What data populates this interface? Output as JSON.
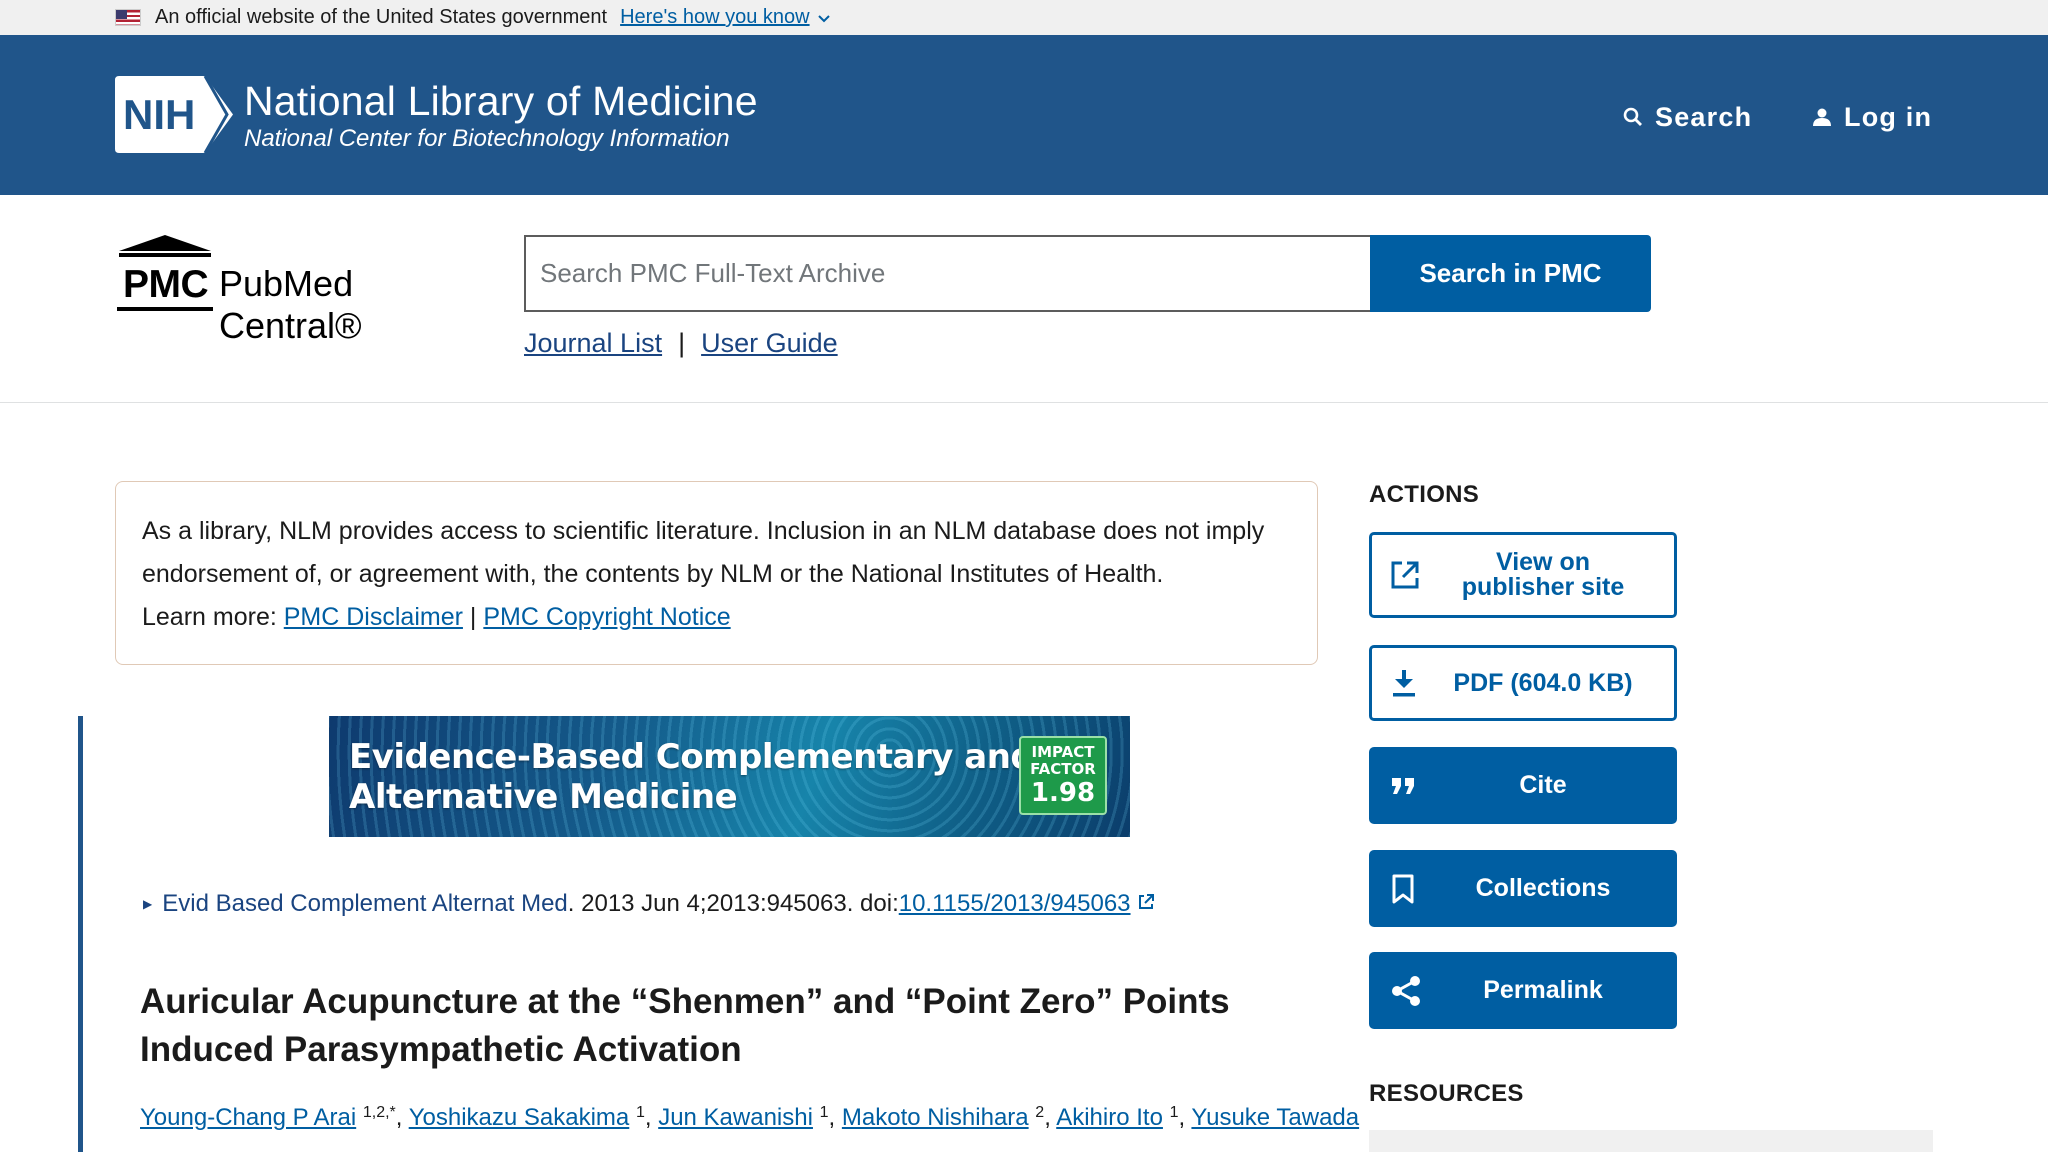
{
  "gov_banner": {
    "text": "An official website of the United States government",
    "link": "Here's how you know"
  },
  "header": {
    "logo_text": "NIH",
    "title": "National Library of Medicine",
    "subtitle": "National Center for Biotechnology Information",
    "search_label": "Search",
    "login_label": "Log in"
  },
  "pmc": {
    "logo_short": "PMC",
    "logo_name": "PubMed Central®",
    "search_placeholder": "Search PMC Full-Text Archive",
    "search_button": "Search in PMC",
    "links": [
      "Journal List",
      "User Guide"
    ],
    "link_separator": "|"
  },
  "disclaimer": {
    "line1": "As a library, NLM provides access to scientific literature. Inclusion in an NLM database does not imply",
    "line2": "endorsement of, or agreement with, the contents by NLM or the National Institutes of Health.",
    "learn_more": "Learn more:",
    "link1": "PMC Disclaimer",
    "separator": "|",
    "link2": "PMC Copyright Notice"
  },
  "journal_banner": {
    "line1": "Evidence-Based Complementary and",
    "line2": "Alternative Medicine",
    "impact_l1": "IMPACT",
    "impact_l2": "FACTOR",
    "impact_value": "1.98"
  },
  "article": {
    "journal": "Evid Based Complement Alternat Med",
    "citation_rest": ". 2013 Jun 4;2013:945063. doi: ",
    "doi": "10.1155/2013/945063",
    "title": "Auricular Acupuncture at the “Shenmen” and “Point Zero” Points Induced Parasympathetic Activation",
    "authors": [
      {
        "name": "Young-Chang P Arai",
        "sup": "1,2,*",
        "sep": ", "
      },
      {
        "name": "Yoshikazu Sakakima",
        "sup": "1",
        "sep": ", "
      },
      {
        "name": "Jun Kawanishi",
        "sup": "1",
        "sep": ", "
      },
      {
        "name": "Makoto Nishihara",
        "sup": "2",
        "sep": ", "
      },
      {
        "name": "Akihiro Ito",
        "sup": "1",
        "sep": ", "
      },
      {
        "name": "Yusuke Tawada",
        "sup": "",
        "sep": ""
      }
    ]
  },
  "sidebar": {
    "actions_heading": "ACTIONS",
    "publisher_line1": "View on",
    "publisher_line2": "publisher site",
    "pdf": "PDF (604.0 KB)",
    "cite": "Cite",
    "collections": "Collections",
    "permalink": "Permalink",
    "resources_heading": "RESOURCES"
  },
  "colors": {
    "header_bg": "#20558a",
    "primary": "#005ea2",
    "link_dark": "#1a4480"
  }
}
